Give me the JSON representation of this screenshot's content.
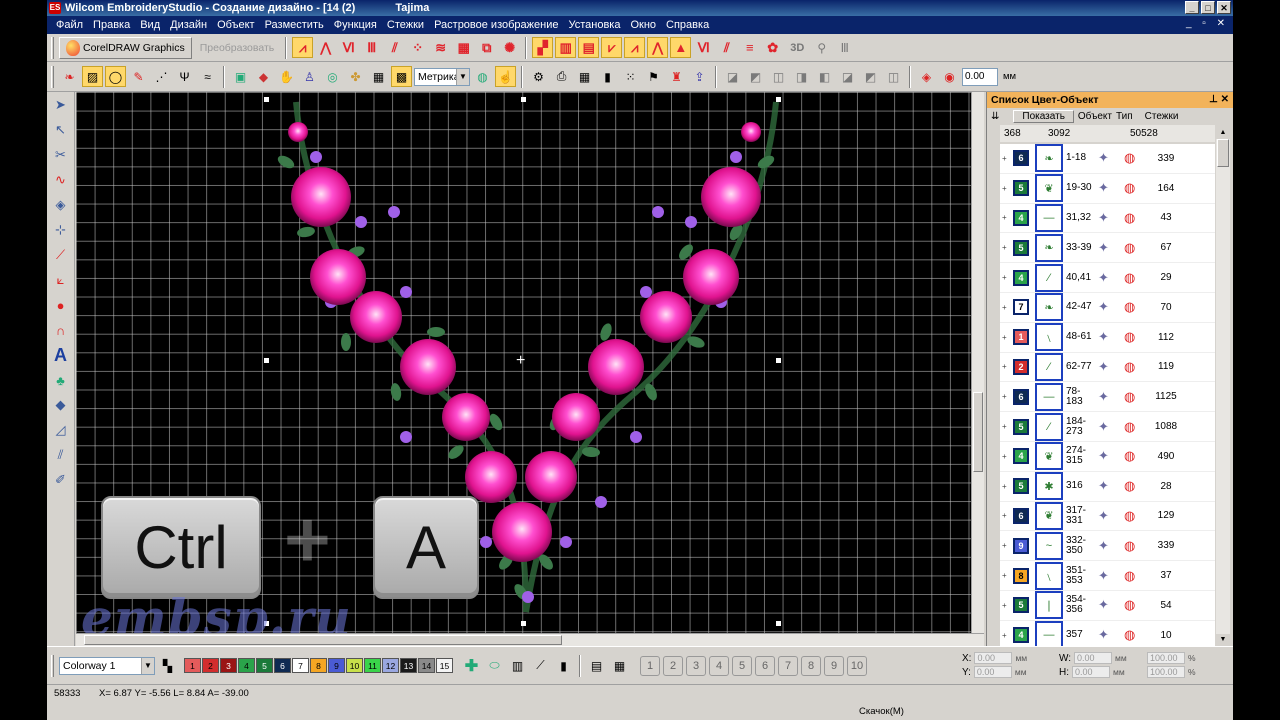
{
  "window": {
    "title": "Wilcom EmbroideryStudio - Создание дизайно - [14 (2)",
    "machine": "Tajima",
    "app_icon": "ES"
  },
  "menu": [
    "Файл",
    "Правка",
    "Вид",
    "Дизайн",
    "Объект",
    "Разместить",
    "Функция",
    "Стежки",
    "Растровое изображение",
    "Установка",
    "Окно",
    "Справка"
  ],
  "toolbar1": {
    "corel_label": "CorelDRAW Graphics",
    "convert_label": "Преобразовать",
    "text_3d": "3D"
  },
  "toolbar2": {
    "units_select": "Метрика",
    "angle_value": "0.00",
    "angle_unit": "мм"
  },
  "docker": {
    "title": "Список Цвет-Объект",
    "show_button": "Показать",
    "col_object": "Объект",
    "col_type": "Тип",
    "col_stitches": "Стежки",
    "summary_colors": "368",
    "summary_objects": "3092",
    "summary_stitches": "50528",
    "rows": [
      {
        "n": "6",
        "color": "#0f2a52",
        "range": "1-18",
        "stitches": "339",
        "glyph": "❧"
      },
      {
        "n": "5",
        "color": "#1b7a3a",
        "range": "19-30",
        "stitches": "164",
        "glyph": "❦"
      },
      {
        "n": "4",
        "color": "#2aa34a",
        "range": "31,32",
        "stitches": "43",
        "glyph": "—"
      },
      {
        "n": "5",
        "color": "#1b7a3a",
        "range": "33-39",
        "stitches": "67",
        "glyph": "❧"
      },
      {
        "n": "4",
        "color": "#2aa34a",
        "range": "40,41",
        "stitches": "29",
        "glyph": "⁄"
      },
      {
        "n": "7",
        "color": "#ffffff",
        "range": "42-47",
        "stitches": "70",
        "glyph": "❧"
      },
      {
        "n": "1",
        "color": "#e45b5b",
        "range": "48-61",
        "stitches": "112",
        "glyph": "﹨"
      },
      {
        "n": "2",
        "color": "#d22d2d",
        "range": "62-77",
        "stitches": "119",
        "glyph": "⁄"
      },
      {
        "n": "6",
        "color": "#0f2a52",
        "range": "78-183",
        "stitches": "1125",
        "glyph": "—"
      },
      {
        "n": "5",
        "color": "#1b7a3a",
        "range": "184-273",
        "stitches": "1088",
        "glyph": "⁄"
      },
      {
        "n": "4",
        "color": "#2aa34a",
        "range": "274-315",
        "stitches": "490",
        "glyph": "❦"
      },
      {
        "n": "5",
        "color": "#1b7a3a",
        "range": "316",
        "stitches": "28",
        "glyph": "✱"
      },
      {
        "n": "6",
        "color": "#0f2a52",
        "range": "317-331",
        "stitches": "129",
        "glyph": "❦"
      },
      {
        "n": "9",
        "color": "#4a5bd4",
        "range": "332-350",
        "stitches": "339",
        "glyph": "~"
      },
      {
        "n": "8",
        "color": "#f5a623",
        "range": "351-353",
        "stitches": "37",
        "glyph": "﹨"
      },
      {
        "n": "5",
        "color": "#1b7a3a",
        "range": "354-356",
        "stitches": "54",
        "glyph": "❘"
      },
      {
        "n": "4",
        "color": "#2aa34a",
        "range": "357",
        "stitches": "10",
        "glyph": "—"
      }
    ]
  },
  "bottom": {
    "colorway": "Colorway 1",
    "palette": [
      {
        "n": "1",
        "color": "#e45b5b"
      },
      {
        "n": "2",
        "color": "#d22d2d"
      },
      {
        "n": "3",
        "color": "#9a1414"
      },
      {
        "n": "4",
        "color": "#2aa34a"
      },
      {
        "n": "5",
        "color": "#1b7a3a"
      },
      {
        "n": "6",
        "color": "#0f2a52"
      },
      {
        "n": "7",
        "color": "#ffffff"
      },
      {
        "n": "8",
        "color": "#f5a623"
      },
      {
        "n": "9",
        "color": "#4a5bd4"
      },
      {
        "n": "10",
        "color": "#c8e04a"
      },
      {
        "n": "11",
        "color": "#3ad44a"
      },
      {
        "n": "12",
        "color": "#9aa7e0"
      },
      {
        "n": "13",
        "color": "#1a1a1a"
      },
      {
        "n": "14",
        "color": "#8a8a8a"
      },
      {
        "n": "15",
        "color": "#f4f4f4"
      }
    ],
    "number_buttons": [
      "1",
      "2",
      "3",
      "4",
      "5",
      "6",
      "7",
      "8",
      "9",
      "10"
    ],
    "coords": {
      "x_label": "X:",
      "x_val": "0.00",
      "y_label": "Y:",
      "y_val": "0.00",
      "w_label": "W:",
      "w_val": "0.00",
      "h_label": "H:",
      "h_val": "0.00",
      "pct1": "100.00",
      "pct2": "100.00",
      "unit": "мм",
      "pct": "%"
    }
  },
  "status": {
    "stitch_count": "58333",
    "cursor": "X=   6.87 Y=  -5.56 L=   8.84 A= -39.00",
    "right_text": "Скачок(М)"
  },
  "overlay": {
    "key1": "Ctrl",
    "key2": "A",
    "plus": "+",
    "watermark": "embsp.ru"
  }
}
